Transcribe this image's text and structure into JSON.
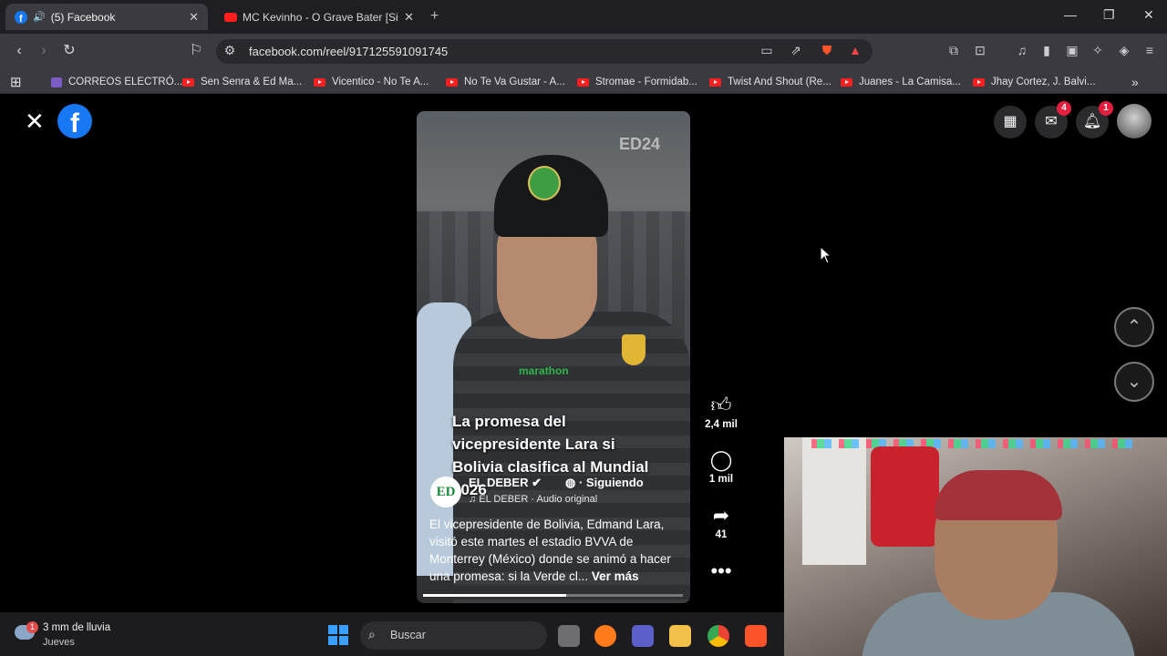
{
  "browser": {
    "tabs": [
      {
        "title": "(5) Facebook",
        "active": true
      },
      {
        "title": "MC Kevinho - O Grave Bater [Sintonia",
        "active": false
      }
    ],
    "url": "facebook.com/reel/917125591091745",
    "bookmarks": [
      "CORREOS ELECTRÓ...",
      "Sen Senra & Ed Ma...",
      "Vicentico - No Te A...",
      "No Te Va Gustar - A...",
      "Stromae - Formidab...",
      "Twist And Shout (Re...",
      "Juanes - La Camisa...",
      "Jhay Cortez, J. Balvi..."
    ]
  },
  "reel": {
    "overlay_title": "La promesa del vicepresidente Lara si Bolivia clasifica al Mundial 2026",
    "watermark": "ED24",
    "jersey_text": "marathon",
    "author": {
      "avatar_text": "ED",
      "name": "EL DEBER",
      "follow_label": "Siguiendo"
    },
    "audio": "EL DEBER · Audio original",
    "caption": "El vicepresidente de Bolivia, Edmand Lara, visitó este martes el estadio BVVA de Monterrey (México) donde se animó a hacer una promesa: si la Verde cl...",
    "see_more": "Ver más",
    "progress_fraction": 0.55,
    "actions": {
      "like_count": "2,4 mil",
      "comment_count": "1 mil",
      "share_count": "41"
    }
  },
  "header": {
    "messenger_badge": "4",
    "notifications_badge": "1"
  },
  "taskbar": {
    "weather_badge": "1",
    "weather_main": "3 mm de lluvia",
    "weather_sub": "Jueves",
    "search_placeholder": "Buscar"
  },
  "icons": {
    "close": "close-icon",
    "facebook": "facebook-logo-icon",
    "menu": "grid-menu-icon",
    "messenger": "messenger-icon",
    "notifications": "bell-icon",
    "like": "thumbs-up-icon",
    "comment": "comment-icon",
    "share": "share-icon",
    "more": "more-icon",
    "up": "chevron-up-icon",
    "down": "chevron-down-icon"
  },
  "colors": {
    "facebook_blue": "#1877f2",
    "badge_red": "#e41e3f",
    "browser_chrome": "#3a3a40"
  }
}
